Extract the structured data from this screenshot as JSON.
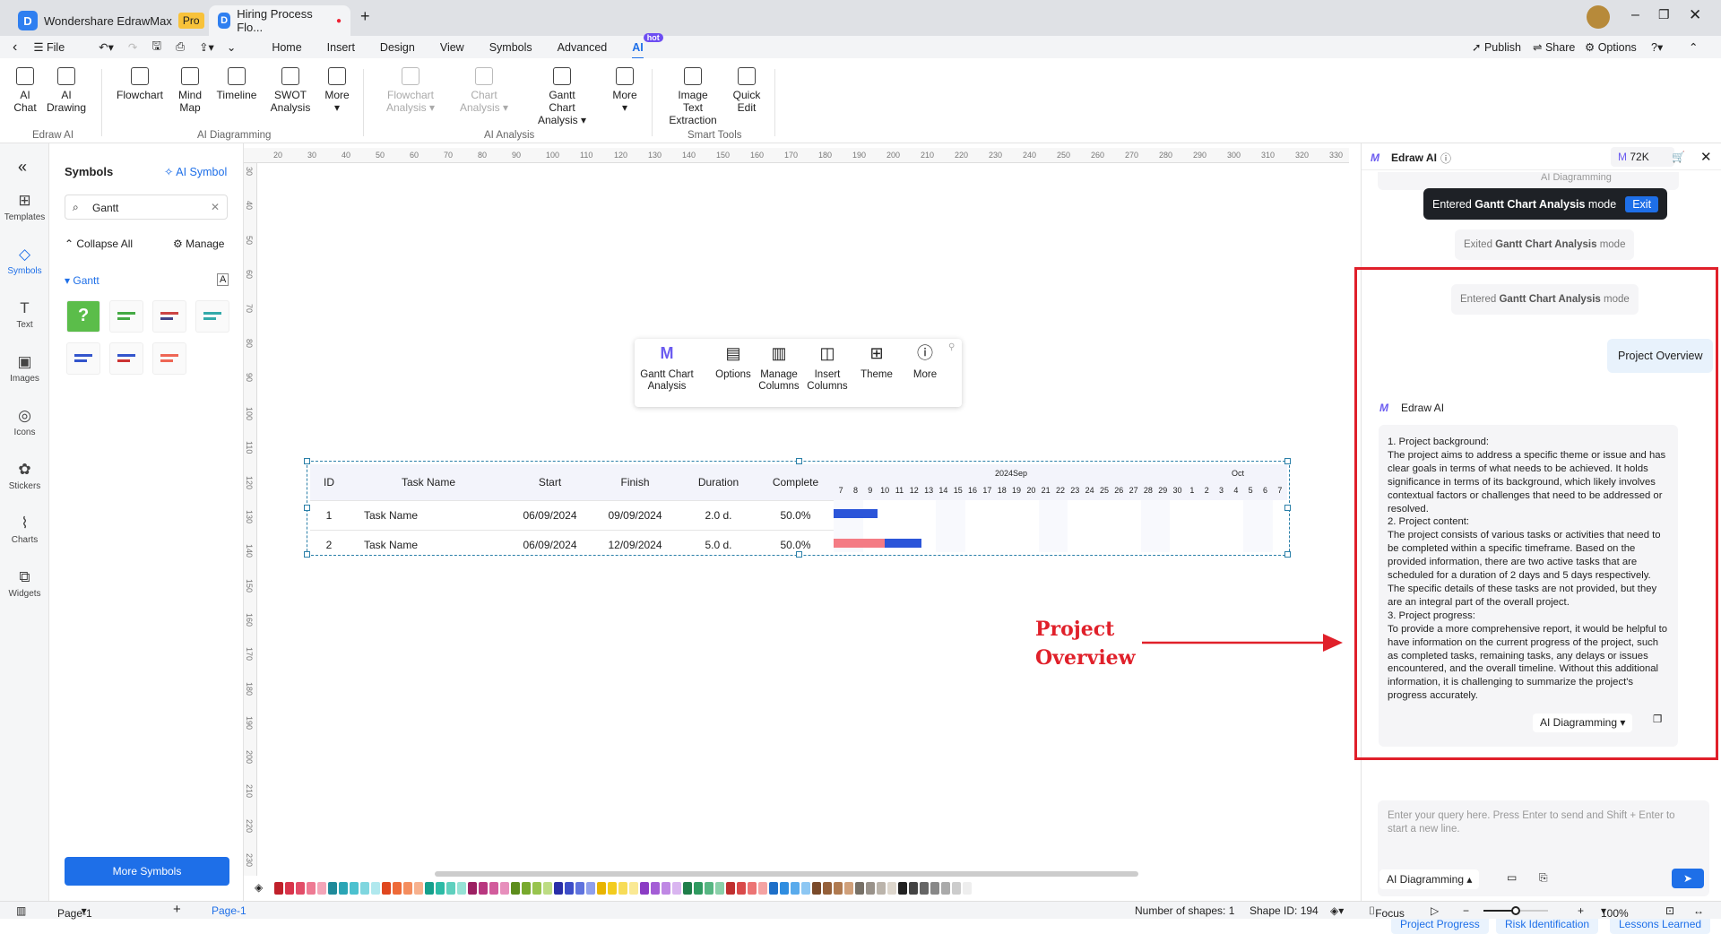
{
  "titlebar": {
    "app_name": "Wondershare EdrawMax",
    "badge": "Pro",
    "doc_tab": "Hiring Process Flo...",
    "new_tab": "+"
  },
  "menubar": {
    "file": "File",
    "tabs": [
      "Home",
      "Insert",
      "Design",
      "View",
      "Symbols",
      "Advanced",
      "AI"
    ],
    "hot": "hot",
    "publish": "Publish",
    "share": "Share",
    "options": "Options"
  },
  "ribbon": {
    "groups": [
      "Edraw AI",
      "AI Diagramming",
      "AI Analysis",
      "Smart Tools"
    ],
    "buttons": [
      {
        "l1": "AI",
        "l2": "Chat",
        "icon": "ai-chat-icon"
      },
      {
        "l1": "AI",
        "l2": "Drawing",
        "icon": "ai-drawing-icon"
      },
      {
        "l1": "Flowchart",
        "l2": "",
        "icon": "flowchart-icon"
      },
      {
        "l1": "Mind",
        "l2": "Map",
        "icon": "mind-map-icon"
      },
      {
        "l1": "Timeline",
        "l2": "",
        "icon": "timeline-icon"
      },
      {
        "l1": "SWOT",
        "l2": "Analysis",
        "icon": "swot-icon"
      },
      {
        "l1": "More",
        "l2": "▾",
        "icon": "plus-icon"
      },
      {
        "l1": "Flowchart",
        "l2": "Analysis ▾",
        "icon": "flowchart-analysis-icon"
      },
      {
        "l1": "Chart",
        "l2": "Analysis ▾",
        "icon": "chart-analysis-icon"
      },
      {
        "l1": "Gantt Chart",
        "l2": "Analysis ▾",
        "icon": "gantt-analysis-icon"
      },
      {
        "l1": "More",
        "l2": "▾",
        "icon": "plus-icon"
      },
      {
        "l1": "Image Text",
        "l2": "Extraction",
        "icon": "ocr-icon"
      },
      {
        "l1": "Quick",
        "l2": "Edit",
        "icon": "quick-edit-icon"
      }
    ]
  },
  "rail": [
    "Templates",
    "Symbols",
    "Text",
    "Images",
    "Icons",
    "Stickers",
    "Charts",
    "Widgets"
  ],
  "symbols": {
    "title": "Symbols",
    "ai_symbol": "AI Symbol",
    "search_value": "Gantt",
    "collapse_all": "Collapse All",
    "manage": "Manage",
    "category": "Gantt",
    "more_symbols": "More Symbols"
  },
  "ruler": {
    "top": [
      "20",
      "30",
      "40",
      "50",
      "60",
      "70",
      "80",
      "90",
      "100",
      "110",
      "120",
      "130",
      "140",
      "150",
      "160",
      "170",
      "180",
      "190",
      "200",
      "210",
      "220",
      "230",
      "240",
      "250",
      "260",
      "270",
      "280",
      "290",
      "300",
      "310",
      "320",
      "330"
    ],
    "left": [
      "30",
      "40",
      "50",
      "60",
      "70",
      "80",
      "90",
      "100",
      "110",
      "120",
      "130",
      "140",
      "150",
      "160",
      "170",
      "180",
      "190",
      "200",
      "210",
      "220",
      "230"
    ]
  },
  "floating_toolbar": [
    "Gantt Chart Analysis",
    "Options",
    "Manage Columns",
    "Insert Columns",
    "Theme",
    "More"
  ],
  "gantt": {
    "headers": [
      "ID",
      "Task Name",
      "Start",
      "Finish",
      "Duration",
      "Complete"
    ],
    "months": [
      "2024Sep",
      "Oct"
    ],
    "days": [
      "7",
      "8",
      "9",
      "10",
      "11",
      "12",
      "13",
      "14",
      "15",
      "16",
      "17",
      "18",
      "19",
      "20",
      "21",
      "22",
      "23",
      "24",
      "25",
      "26",
      "27",
      "28",
      "29",
      "30",
      "1",
      "2",
      "3",
      "4",
      "5",
      "6",
      "7"
    ],
    "rows": [
      {
        "id": "1",
        "name": "Task Name",
        "start": "06/09/2024",
        "finish": "09/09/2024",
        "duration": "2.0 d.",
        "complete": "50.0%"
      },
      {
        "id": "2",
        "name": "Task Name",
        "start": "06/09/2024",
        "finish": "12/09/2024",
        "duration": "5.0 d.",
        "complete": "50.0%"
      }
    ],
    "colors": {
      "done": "#f47b84",
      "remaining": "#2b55d9"
    }
  },
  "annotation": {
    "line1": "Project",
    "line2": "Overview",
    "color": "#e0202a"
  },
  "ai_panel": {
    "title": "Edraw AI",
    "credits": "72K",
    "toast": {
      "pre": "Entered ",
      "bold": "Gantt Chart Analysis",
      "post": " mode",
      "exit": "Exit"
    },
    "behind_select": "AI Diagramming",
    "exited": {
      "pre": "Exited ",
      "bold": "Gantt Chart Analysis",
      "post": " mode"
    },
    "entered": {
      "pre": "Entered ",
      "bold": "Gantt Chart Analysis",
      "post": " mode"
    },
    "user_msg": "Project Overview",
    "bot_name": "Edraw AI",
    "response": [
      "1. Project background:",
      "The project aims to address a specific theme or issue and has clear goals in terms of what needs to be achieved. It holds significance in terms of its background, which likely involves contextual factors or challenges that need to be addressed or resolved.",
      "2. Project content:",
      "The project consists of various tasks or activities that need to be completed within a specific timeframe. Based on the provided information, there are two active tasks that are scheduled for a duration of 2 days and 5 days respectively. The specific details of these tasks are not provided, but they are an integral part of the overall project.",
      "3. Project progress:",
      "To provide a more comprehensive report, it would be helpful to have information on the current progress of the project, such as completed tasks, remaining tasks, any delays or issues encountered, and the overall timeline. Without this additional information, it is challenging to summarize the project's progress accurately."
    ],
    "response_select": "AI Diagramming",
    "chips": [
      "Project Progress",
      "Risk Identification",
      "Lessons Learned"
    ],
    "input_placeholder": "Enter your query here. Press Enter to send and Shift + Enter to start a new line.",
    "mode_select": "AI Diagramming"
  },
  "palette": [
    "#c0202a",
    "#d8344a",
    "#e24d68",
    "#ee7a93",
    "#f3a5b8",
    "#1f8a9a",
    "#2aa5b5",
    "#4cc1cf",
    "#7fd6df",
    "#b0e8ee",
    "#e0471f",
    "#ee6a38",
    "#f48d5e",
    "#f7b18e",
    "#14a08c",
    "#2dbba6",
    "#5fd0be",
    "#96e2d5",
    "#9c2062",
    "#b8377f",
    "#d25c9c",
    "#e78fbc",
    "#5d8d1c",
    "#78a92d",
    "#98c44e",
    "#bddc83",
    "#2a2fa8",
    "#3d4ec8",
    "#5f73de",
    "#8f9fec",
    "#e8b400",
    "#f3cc1d",
    "#f7dc58",
    "#fae994",
    "#8b3cc4",
    "#a45ed6",
    "#bf88e4",
    "#d9b5f0",
    "#1f7d4a",
    "#2f9a60",
    "#57b682",
    "#8ad0a9",
    "#c02f2f",
    "#d94a4a",
    "#ec7474",
    "#f4a3a3",
    "#1e6fc8",
    "#2f8de0",
    "#5aabec",
    "#8dc7f3",
    "#7a4a2a",
    "#95603a",
    "#b07a50",
    "#d0a07a",
    "#777066",
    "#99928a",
    "#bbb4ab",
    "#ddd6cc",
    "#222222",
    "#444444",
    "#666666",
    "#888888",
    "#aaaaaa",
    "#cccccc",
    "#eeeeee"
  ],
  "status": {
    "page_select": "Page-1",
    "add": "+",
    "page_tab": "Page-1",
    "shapes": "Number of shapes: 1",
    "shape_id": "Shape ID: 194",
    "focus": "Focus",
    "zoom": "100%",
    "zoom_level": 0.5
  }
}
